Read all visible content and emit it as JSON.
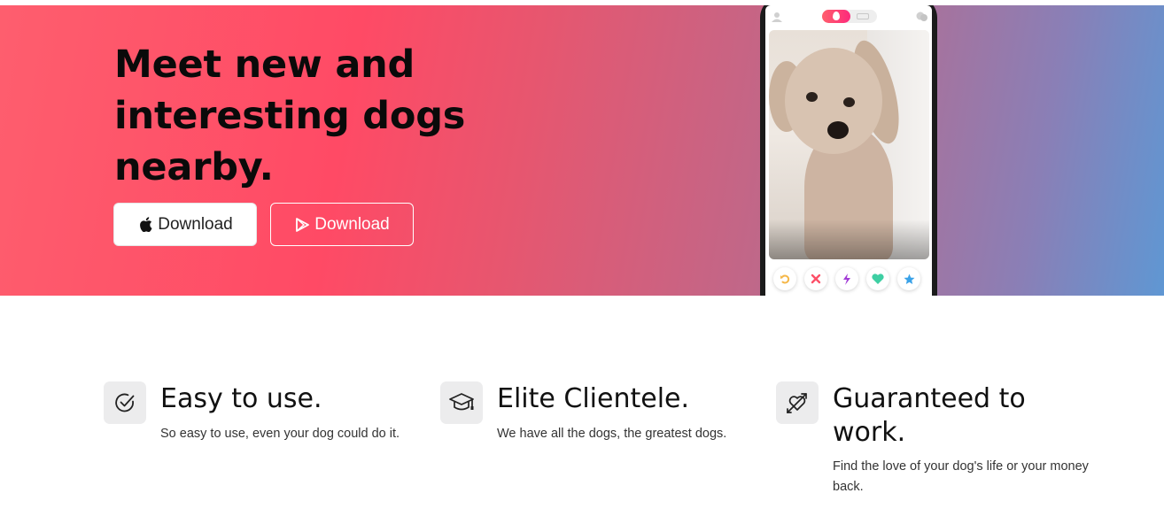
{
  "hero": {
    "headline": "Meet new and interesting dogs nearby.",
    "apple_button_label": "Download",
    "play_button_label": "Download"
  },
  "phone": {
    "app_icons": [
      "profile-icon",
      "flame-icon",
      "cards-icon",
      "chat-icon"
    ],
    "photo": "dog-photo",
    "actions": [
      "rewind-icon",
      "nope-icon",
      "boost-icon",
      "like-icon",
      "superlike-icon"
    ],
    "action_colors": [
      "#f5b748",
      "#fd5068",
      "#a23bd6",
      "#3ecfa3",
      "#3aa2e8"
    ]
  },
  "features": [
    {
      "icon": "check-circle-icon",
      "title": "Easy to use.",
      "text": "So easy to use, even your dog could do it."
    },
    {
      "icon": "graduation-cap-icon",
      "title": "Elite Clientele.",
      "text": "We have all the dogs, the greatest dogs."
    },
    {
      "icon": "heart-arrow-icon",
      "title": "Guaranteed to work.",
      "text": "Find the love of your dog's life or your money back."
    }
  ],
  "colors": {
    "hero_gradient_start": "#fe5e6e",
    "hero_gradient_mid": "#ff4a65",
    "hero_gradient_end": "#5f97d3",
    "icon_tile": "#ececed"
  }
}
